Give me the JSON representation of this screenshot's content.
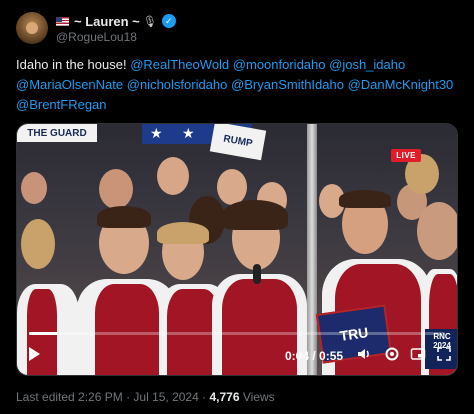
{
  "author": {
    "display_name": "~ Lauren ~",
    "handle": "@RogueLou18",
    "verified": true
  },
  "tweet": {
    "text_lead": "Idaho in the house!",
    "mentions": [
      "@RealTheoWold",
      "@moonforidaho",
      "@josh_idaho",
      "@MariaOlsenNate",
      "@nicholsforidaho",
      "@BryanSmithIdaho",
      "@DanMcKnight30",
      "@BrentFRegan"
    ]
  },
  "video": {
    "live_badge": "LIVE",
    "current_time": "0:04",
    "duration": "0:55",
    "time_label": "0:04 / 0:55",
    "progress_fraction": 0.07,
    "sign_left": "THE GUARD",
    "sign_right": "RUMP",
    "sign_trump": "TRU",
    "rnc_label": "RNC 2024"
  },
  "meta": {
    "edited_label": "Last edited 2:26 PM · Jul 15, 2024 ·",
    "views_count": "4,776",
    "views_label": "Views"
  }
}
